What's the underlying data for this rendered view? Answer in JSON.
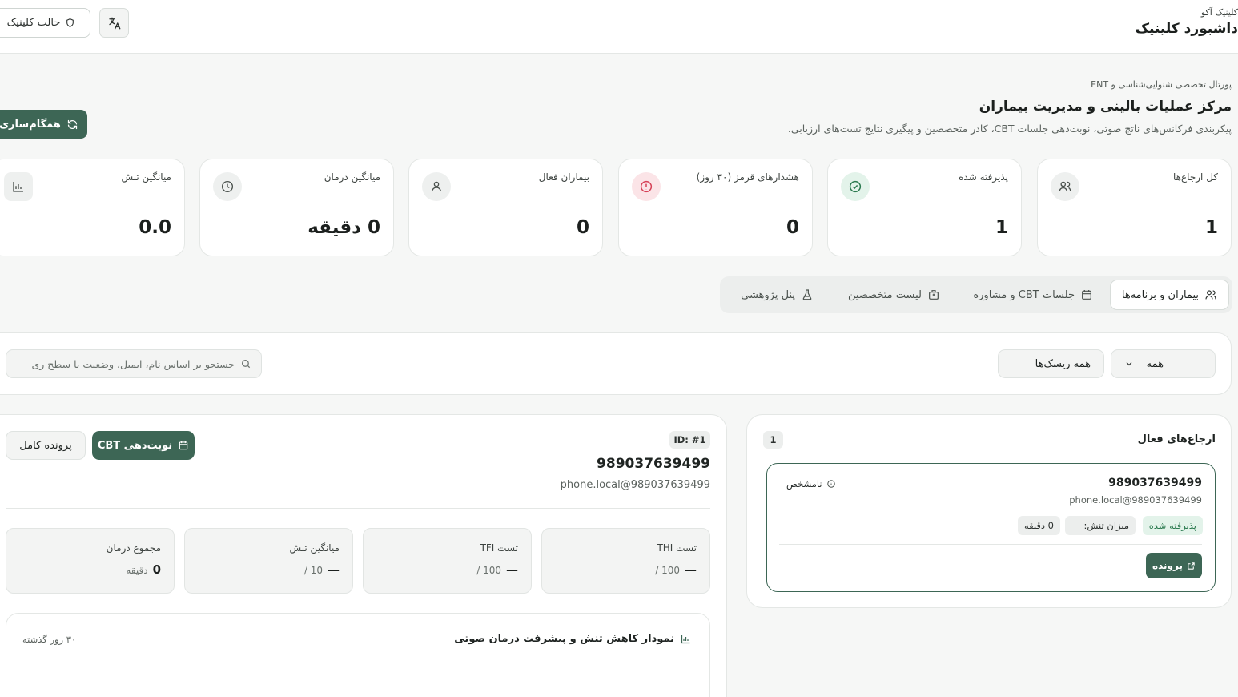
{
  "topbar": {
    "brand_sub": "کلینیک آکو",
    "brand_title": "داشبورد کلینیک",
    "mode_label": "حالت کلینیک"
  },
  "header": {
    "eyebrow": "پورتال تخصصی شنوایی‌شناسی و ENT",
    "title": "مرکز عملیات بالینی و مدیریت بیماران",
    "description": "پیکربندی فرکانس‌های ناتج صوتی، نوبت‌دهی جلسات CBT، کادر متخصصین و پیگیری نتایج تست‌های ارزیابی.",
    "sync_label": "همگام‌سازی"
  },
  "stats": [
    {
      "label": "کل ارجاع‌ها",
      "value": "1",
      "icon": "users-icon"
    },
    {
      "label": "پذیرفته شده",
      "value": "1",
      "icon": "check-circle-icon"
    },
    {
      "label": "هشدارهای قرمز (۳۰ روز)",
      "value": "0",
      "icon": "alert-circle-icon"
    },
    {
      "label": "بیماران فعال",
      "value": "0",
      "icon": "user-icon"
    },
    {
      "label": "میانگین درمان",
      "value": "0 دقیقه",
      "icon": "clock-icon"
    },
    {
      "label": "میانگین تنش",
      "value": "0.0",
      "icon": "bar-chart-icon"
    }
  ],
  "tabs": [
    {
      "label": "بیماران و برنامه‌ها",
      "icon": "users-icon",
      "active": true
    },
    {
      "label": "جلسات CBT و مشاوره",
      "icon": "calendar-icon",
      "active": false
    },
    {
      "label": "لیست متخصصین",
      "icon": "briefcase-icon",
      "active": false
    },
    {
      "label": "پنل پژوهشی",
      "icon": "flask-icon",
      "active": false
    }
  ],
  "filters": {
    "status_value": "همه",
    "risk_value": "همه ریسک‌ها",
    "search_placeholder": "جستجو بر اساس نام، ایمیل، وضعیت یا سطح ری"
  },
  "referrals": {
    "title": "ارجاع‌های فعال",
    "count": "1",
    "items": [
      {
        "name": "989037639499",
        "email": "phone.local@989037639499",
        "risk": "نامشخص",
        "status": "پذیرفته شده",
        "stress": "میزان تنش: —",
        "duration": "0 دقیقه",
        "open_label": "پرونده"
      }
    ]
  },
  "patient": {
    "id": "ID: #1",
    "name": "989037639499",
    "email": "phone.local@989037639499",
    "schedule_label": "نوبت‌دهی CBT",
    "file_label": "پرونده کامل",
    "metrics": [
      {
        "label": "تست THI",
        "value": "—",
        "unit": "100 /"
      },
      {
        "label": "تست TFI",
        "value": "—",
        "unit": "100 /"
      },
      {
        "label": "میانگین تنش",
        "value": "—",
        "unit": "10 /"
      },
      {
        "label": "مجموع درمان",
        "value": "0",
        "unit": "دقیقه"
      }
    ],
    "chart_title": "نمودار کاهش تنش و پیشرفت درمان صوتی",
    "chart_range": "۳۰ روز گذشته"
  },
  "colors": {
    "accent": "#3d6655",
    "success": "#2b7a4f",
    "danger": "#d64157"
  }
}
